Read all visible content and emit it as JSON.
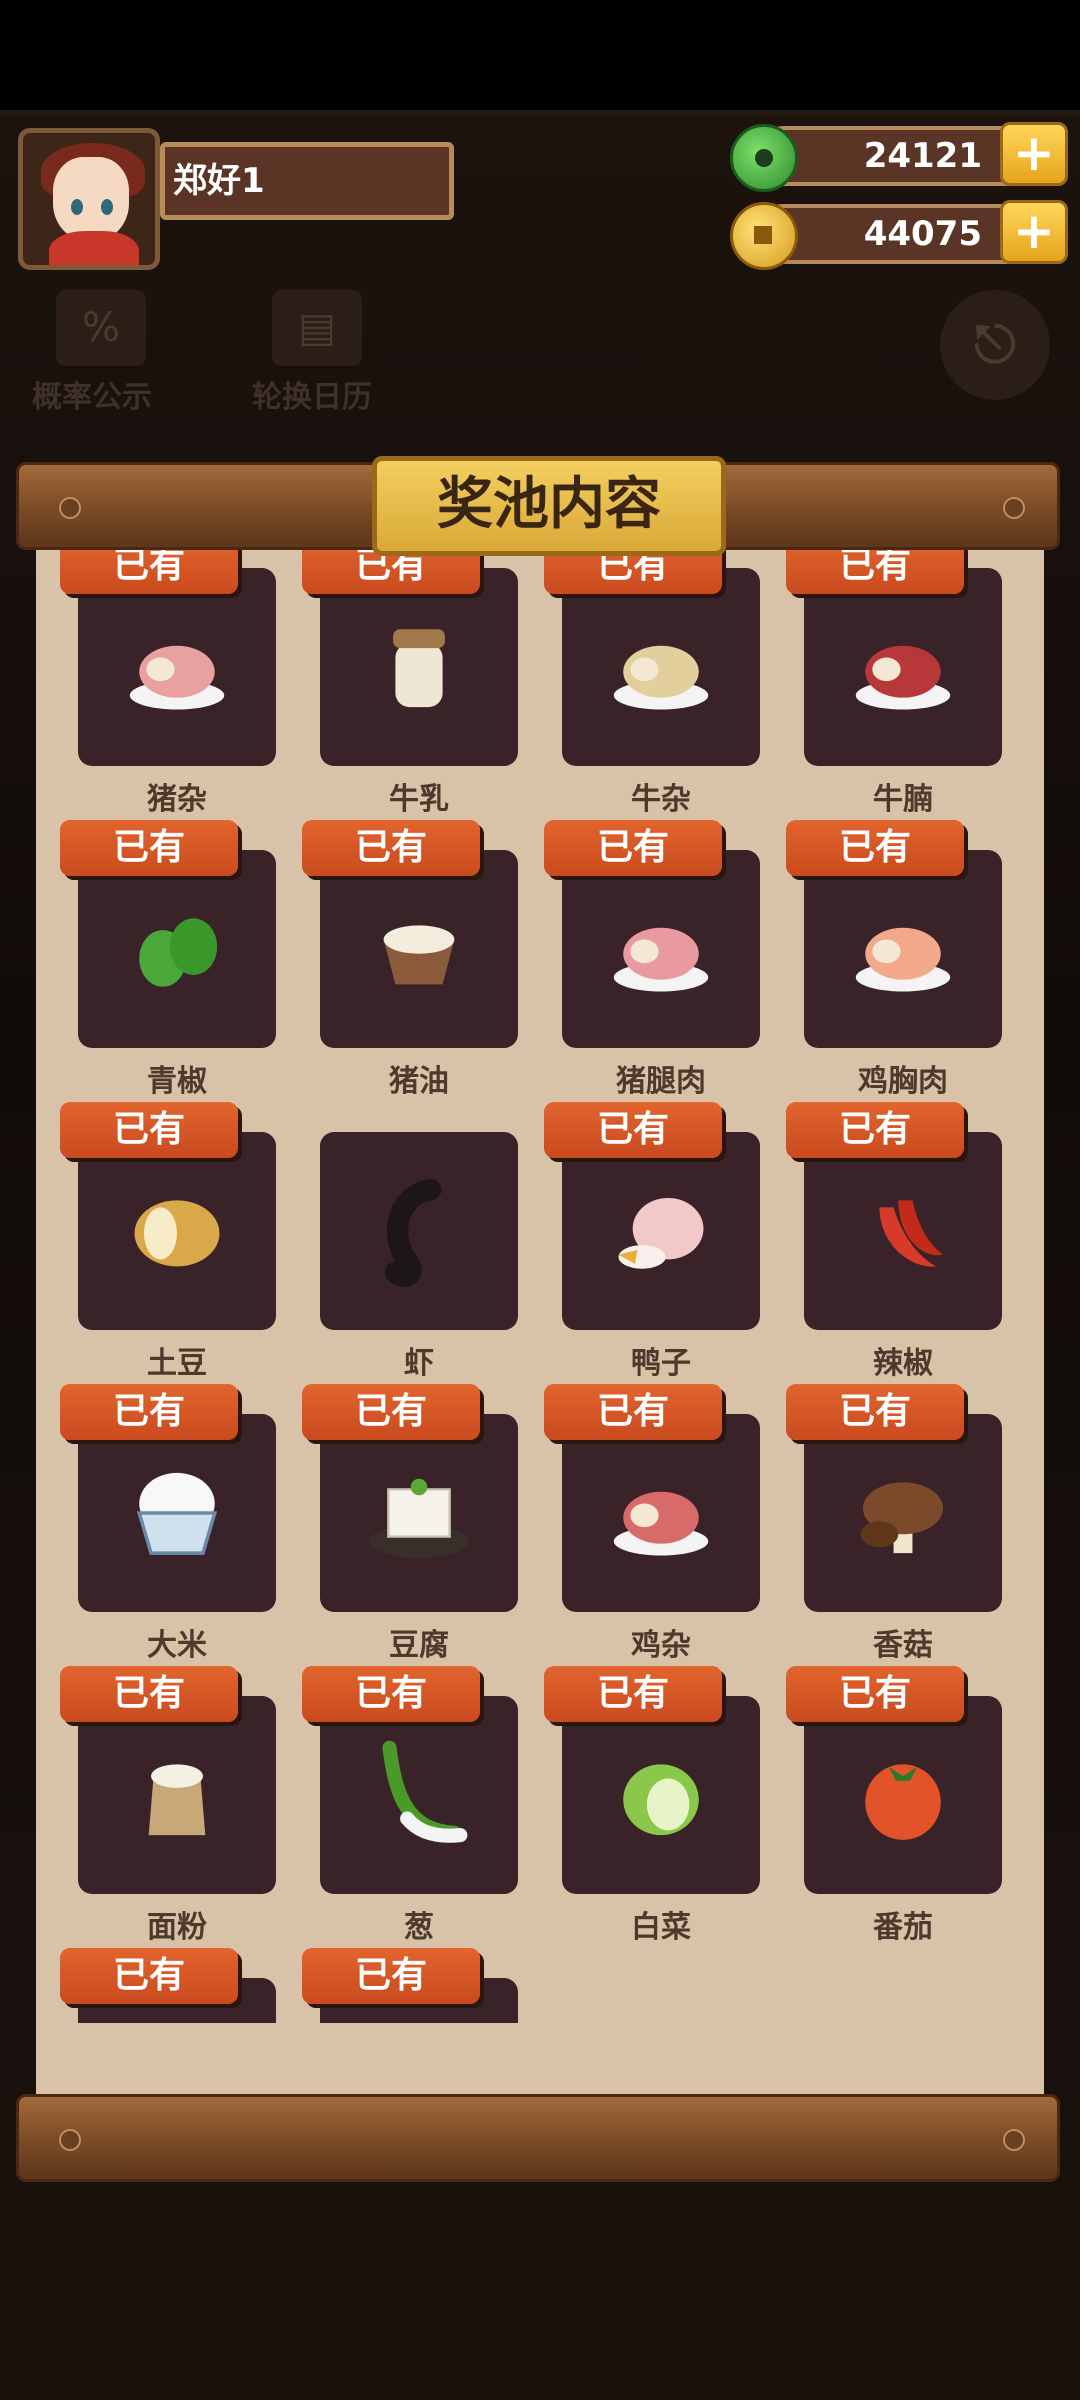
{
  "player": {
    "name": "郑好1"
  },
  "currency": {
    "jade": "24121",
    "coins": "44075"
  },
  "menu": {
    "probability": "概率公示",
    "calendar": "轮换日历"
  },
  "panel": {
    "title": "奖池内容"
  },
  "owned_label": "已有",
  "items": [
    {
      "name": "猪杂",
      "owned": true,
      "icon": "pork-offal-icon",
      "color": "#e8a0a0"
    },
    {
      "name": "牛乳",
      "owned": true,
      "icon": "milk-jar-icon",
      "color": "#efe6d4"
    },
    {
      "name": "牛杂",
      "owned": true,
      "icon": "beef-offal-icon",
      "color": "#e3cf9c"
    },
    {
      "name": "牛腩",
      "owned": true,
      "icon": "beef-brisket-icon",
      "color": "#b8383a"
    },
    {
      "name": "青椒",
      "owned": true,
      "icon": "green-pepper-icon",
      "color": "#4aa83a"
    },
    {
      "name": "猪油",
      "owned": true,
      "icon": "lard-icon",
      "color": "#8a5a3a"
    },
    {
      "name": "猪腿肉",
      "owned": true,
      "icon": "pork-leg-icon",
      "color": "#e89aa0"
    },
    {
      "name": "鸡胸肉",
      "owned": true,
      "icon": "chicken-breast-icon",
      "color": "#f2a88a"
    },
    {
      "name": "土豆",
      "owned": true,
      "icon": "potato-icon",
      "color": "#d8a84a"
    },
    {
      "name": "虾",
      "owned": false,
      "icon": "shrimp-icon",
      "color": "#2a2226"
    },
    {
      "name": "鸭子",
      "owned": true,
      "icon": "duck-icon",
      "color": "#f2c8c8"
    },
    {
      "name": "辣椒",
      "owned": true,
      "icon": "chili-icon",
      "color": "#d83a2a"
    },
    {
      "name": "大米",
      "owned": true,
      "icon": "rice-bowl-icon",
      "color": "#f4f4f4"
    },
    {
      "name": "豆腐",
      "owned": true,
      "icon": "tofu-icon",
      "color": "#f4f2ea"
    },
    {
      "name": "鸡杂",
      "owned": true,
      "icon": "chicken-offal-icon",
      "color": "#d86a6a"
    },
    {
      "name": "香菇",
      "owned": true,
      "icon": "mushroom-icon",
      "color": "#7a4a2a"
    },
    {
      "name": "面粉",
      "owned": true,
      "icon": "flour-sack-icon",
      "color": "#c8a878"
    },
    {
      "name": "葱",
      "owned": true,
      "icon": "scallion-icon",
      "color": "#4a9a2a"
    },
    {
      "name": "白菜",
      "owned": true,
      "icon": "cabbage-icon",
      "color": "#8ac84a"
    },
    {
      "name": "番茄",
      "owned": true,
      "icon": "tomato-icon",
      "color": "#e2532a"
    }
  ],
  "partial_row": [
    {
      "owned": true
    },
    {
      "owned": true
    }
  ]
}
